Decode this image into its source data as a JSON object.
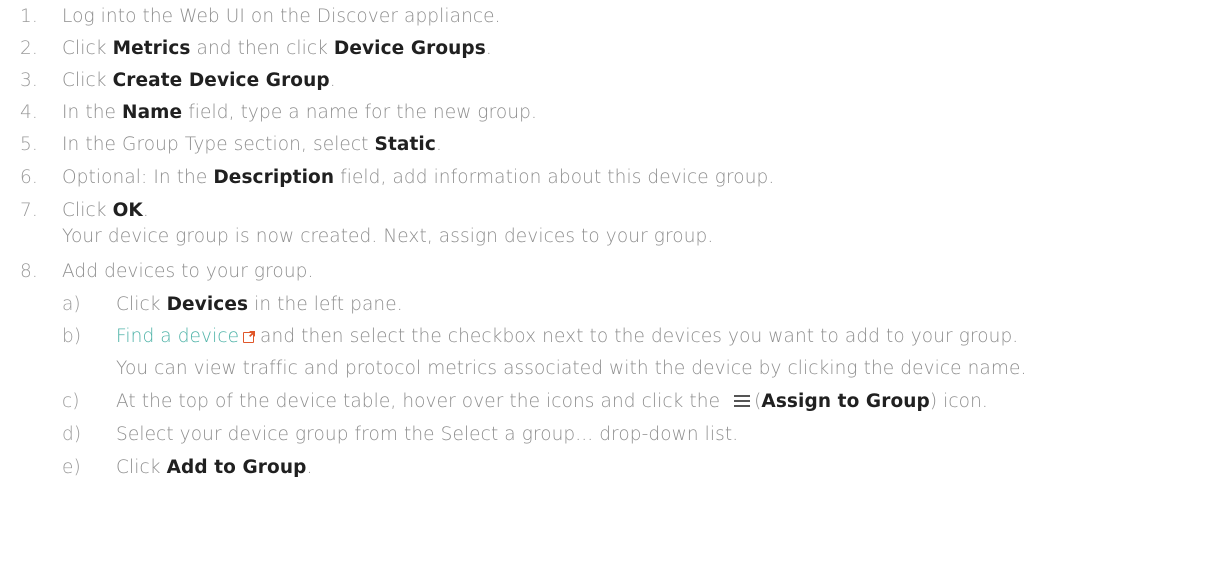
{
  "steps": [
    {
      "num": "1.",
      "t1": "Log into the Web UI on the Discover appliance."
    },
    {
      "num": "2.",
      "t1": "Click ",
      "b1": "Metrics",
      "t2": " and then click ",
      "b2": "Device Groups",
      "t3": "."
    },
    {
      "num": "3.",
      "t1": "Click ",
      "b1": "Create Device Group",
      "t2": "."
    },
    {
      "num": "4.",
      "t1": "In the ",
      "b1": "Name",
      "t2": " field, type a name for the new group."
    },
    {
      "num": "5.",
      "t1": "In the Group Type section, select ",
      "b1": "Static",
      "t2": "."
    },
    {
      "num": "6.",
      "t1": "Optional: In the ",
      "b1": "Description",
      "t2": " field, add information about this device group."
    },
    {
      "num": "7.",
      "t1": "Click ",
      "b1": "OK",
      "t2": ".",
      "note": "Your device group is now created. Next, assign devices to your group."
    },
    {
      "num": "8.",
      "t1": "Add devices to your group."
    }
  ],
  "substeps": [
    {
      "num": "a)",
      "t1": "Click ",
      "b1": "Devices",
      "t2": " in the left pane."
    },
    {
      "num": "b)",
      "link": "Find a device",
      "link_icon": "external-link-icon",
      "t1": " and then select the checkbox next to the devices you want to add to your group.",
      "note": "You can view traffic and protocol metrics associated with the device by clicking the device name."
    },
    {
      "num": "c)",
      "t1": "At the top of the device table, hover over the icons and click the ",
      "icon": "list-icon",
      "t2": "(",
      "b1": "Assign to Group",
      "t3": ") icon."
    },
    {
      "num": "d)",
      "t1": "Select your device group from the Select a group... drop-down list."
    },
    {
      "num": "e)",
      "t1": "Click ",
      "b1": "Add to Group",
      "t2": "."
    }
  ]
}
